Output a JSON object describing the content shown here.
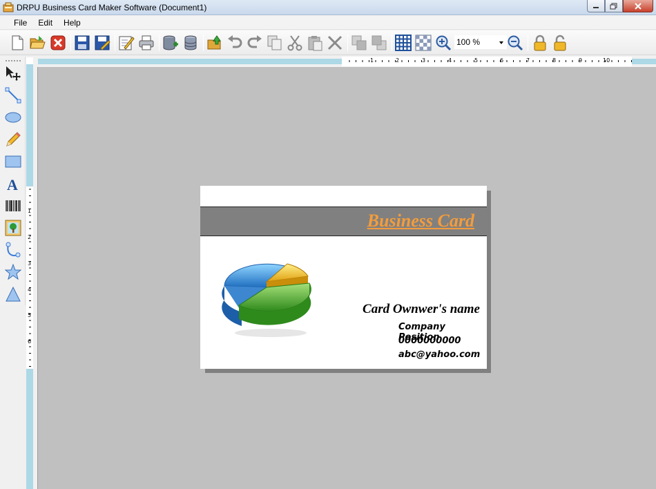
{
  "window": {
    "title": "DRPU Business Card Maker Software  (Document1)",
    "icons": [
      "app-icon",
      "minimize-icon",
      "maximize-icon",
      "close-icon"
    ]
  },
  "menu": {
    "items": [
      "File",
      "Edit",
      "Help"
    ]
  },
  "toolbar": {
    "zoom_value": "100 %",
    "icons": [
      "new-icon",
      "open-icon",
      "close-document-icon",
      "save-icon",
      "save-as-icon",
      "edit-icon",
      "print-icon",
      "database-add-icon",
      "database-icon",
      "export-icon",
      "undo-icon",
      "redo-icon",
      "copy-icon",
      "cut-icon",
      "paste-icon",
      "delete-icon",
      "bring-forward-icon",
      "send-backward-icon",
      "grid-icon",
      "checkerboard-icon",
      "zoom-in-icon",
      "zoom-out-icon",
      "lock-icon",
      "unlock-icon"
    ]
  },
  "left_tools": {
    "icons": [
      "pointer-icon",
      "line-icon",
      "ellipse-icon",
      "pencil-icon",
      "rectangle-icon",
      "text-icon",
      "barcode-icon",
      "image-icon",
      "curve-icon",
      "star-icon",
      "triangle-icon"
    ]
  },
  "rulers": {
    "horizontal_labels": [
      "1",
      "2",
      "3",
      "4",
      "5",
      "6",
      "7",
      "8",
      "9",
      "10"
    ],
    "vertical_labels": [
      "1",
      "2",
      "3",
      "4",
      "5",
      "6"
    ]
  },
  "card": {
    "title": "Business Card",
    "owner_name": "Card Ownwer's name",
    "position": "Company Position",
    "phone": "0000000000",
    "email": "abc@yahoo.com",
    "colors": {
      "title": "#f39c3c",
      "band": "#808080",
      "canvas": "#c0c0c0",
      "ruler_band": "#add8e6"
    },
    "image": "pie-chart-icon"
  }
}
